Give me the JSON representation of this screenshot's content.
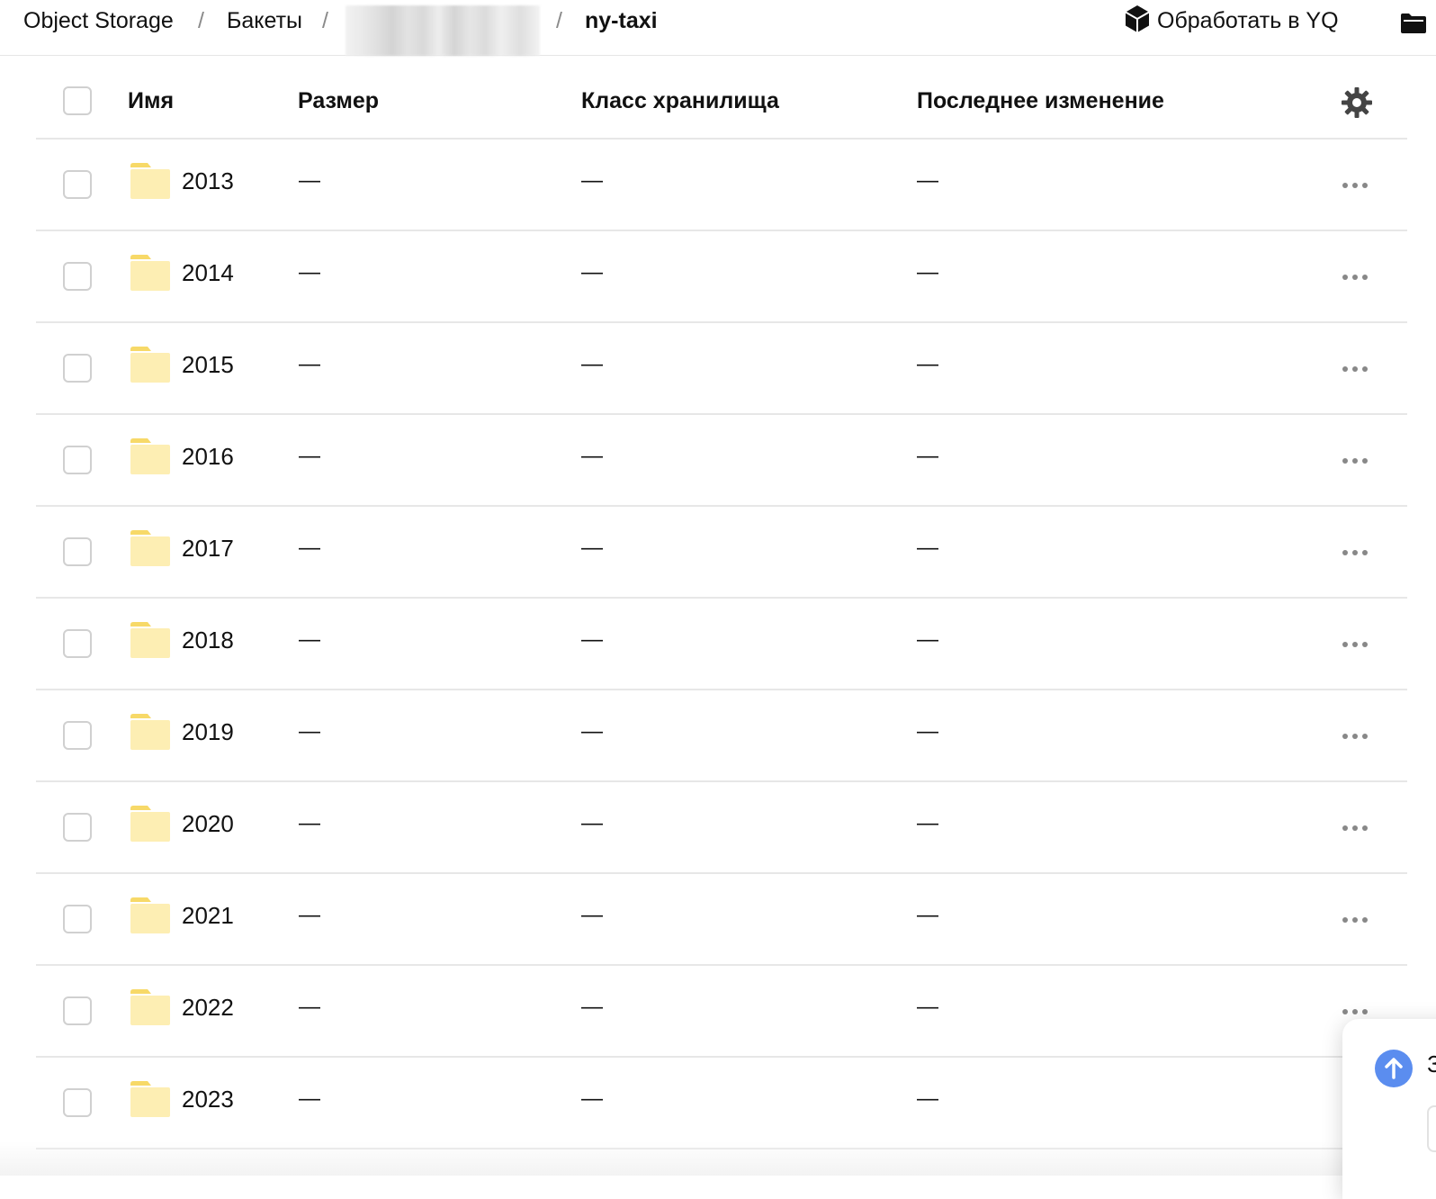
{
  "breadcrumbs": {
    "root": "Object Storage",
    "buckets": "Бакеты",
    "separator": "/",
    "current": "ny-taxi"
  },
  "actions": {
    "process_yq": "Обработать в YQ"
  },
  "table": {
    "columns": {
      "name": "Имя",
      "size": "Размер",
      "storage_class": "Класс хранилища",
      "modified": "Последнее изменение"
    },
    "rows": [
      {
        "name": "2013",
        "size": "—",
        "storage_class": "—",
        "modified": "—"
      },
      {
        "name": "2014",
        "size": "—",
        "storage_class": "—",
        "modified": "—"
      },
      {
        "name": "2015",
        "size": "—",
        "storage_class": "—",
        "modified": "—"
      },
      {
        "name": "2016",
        "size": "—",
        "storage_class": "—",
        "modified": "—"
      },
      {
        "name": "2017",
        "size": "—",
        "storage_class": "—",
        "modified": "—"
      },
      {
        "name": "2018",
        "size": "—",
        "storage_class": "—",
        "modified": "—"
      },
      {
        "name": "2019",
        "size": "—",
        "storage_class": "—",
        "modified": "—"
      },
      {
        "name": "2020",
        "size": "—",
        "storage_class": "—",
        "modified": "—"
      },
      {
        "name": "2021",
        "size": "—",
        "storage_class": "—",
        "modified": "—"
      },
      {
        "name": "2022",
        "size": "—",
        "storage_class": "—",
        "modified": "—"
      },
      {
        "name": "2023",
        "size": "—",
        "storage_class": "—",
        "modified": "—"
      }
    ]
  },
  "upload_panel": {
    "text": "З"
  },
  "colors": {
    "folder": "#fdeeb3",
    "folder_tab": "#f7d968",
    "accent_blue": "#5b8def",
    "border": "#e7e7e7"
  },
  "icons": [
    "yq-icon",
    "folder-icon",
    "gear-icon",
    "more-icon",
    "upload-icon"
  ]
}
